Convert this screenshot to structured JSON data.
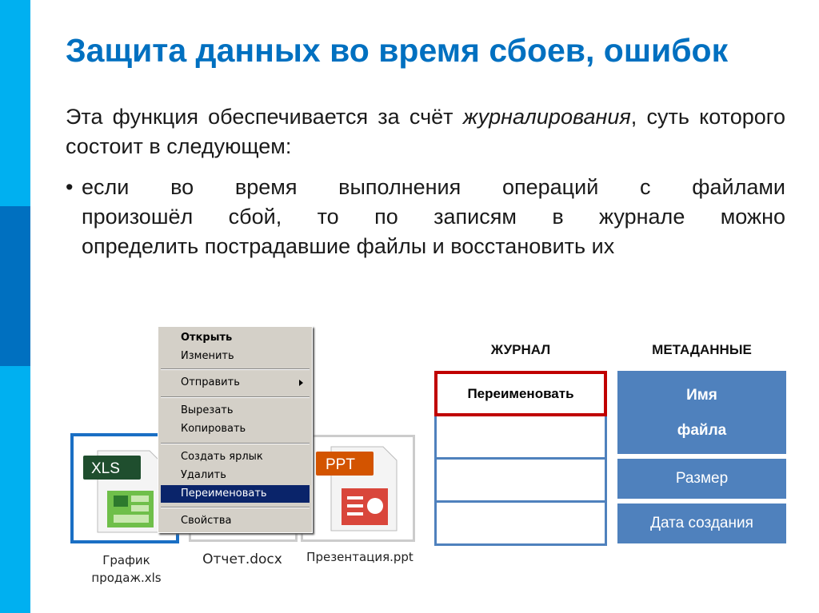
{
  "slide": {
    "title": "Защита данных во время сбоев, ошибок",
    "intro_part1": "Эта функция обеспечивается за счёт ",
    "intro_emphasis": "журналирования",
    "intro_part2": ", суть которого состоит в следующем:",
    "bullet_lines": [
      "если во время выполнения операций с файлами",
      "произошёл сбой, то по записям в журнале можно",
      "определить пострадавшие файлы и восстановить их"
    ],
    "bullet_symbol": "•",
    "colors": {
      "accent": "#0070c0",
      "sidebar": "#00b0f0",
      "sidebar_dark": "#0070c0",
      "journal_highlight": "#c00000",
      "meta_fill": "#4f81bd"
    }
  },
  "files": [
    {
      "label": "XLS",
      "name_line1": "График",
      "name_line2": "продаж.xls",
      "icon": "excel-file-icon",
      "selected": true
    },
    {
      "name_line1": "Отчет.docx",
      "icon": "word-file-icon"
    },
    {
      "label": "PPT",
      "name_line1": "Презентация.ppt",
      "icon": "powerpoint-file-icon"
    }
  ],
  "context_menu": {
    "items": [
      "Открыть",
      "Изменить",
      "Отправить",
      "Вырезать",
      "Копировать",
      "Создать ярлык",
      "Удалить",
      "Переименовать",
      "Свойства"
    ],
    "highlighted": "Переименовать",
    "default": "Открыть"
  },
  "journal": {
    "header": "ЖУРНАЛ",
    "entries": [
      "Переименовать",
      "",
      "",
      ""
    ]
  },
  "metadata": {
    "header": "МЕТАДАННЫЕ",
    "name_line1": "Имя",
    "name_line2": "файла",
    "size": "Размер",
    "created": "Дата создания"
  }
}
